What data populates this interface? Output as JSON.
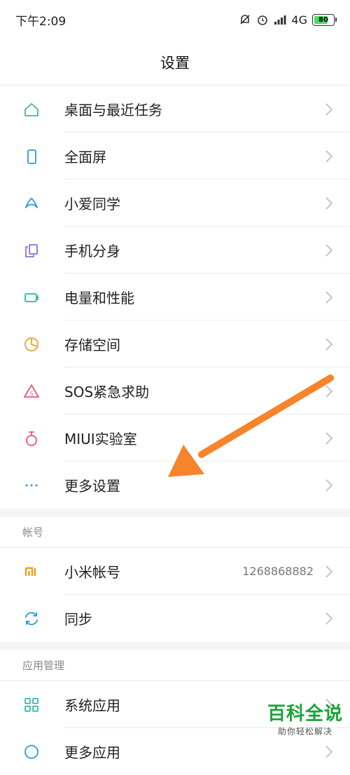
{
  "status_bar": {
    "time": "下午2:09",
    "network": "4G",
    "battery_level": "80",
    "battery_fraction": 0.8
  },
  "header": {
    "title": "设置"
  },
  "sections": [
    {
      "header": "",
      "items": [
        {
          "label": "桌面与最近任务",
          "icon": "home-icon",
          "color": "#3fb6a8"
        },
        {
          "label": "全面屏",
          "icon": "phone-icon",
          "color": "#2a9bd8"
        },
        {
          "label": "小爱同学",
          "icon": "assistant-icon",
          "color": "#2a9bd8"
        },
        {
          "label": "手机分身",
          "icon": "dual-space-icon",
          "color": "#8a6fd6"
        },
        {
          "label": "电量和性能",
          "icon": "battery-icon",
          "color": "#2bb5a0"
        },
        {
          "label": "存储空间",
          "icon": "storage-icon",
          "color": "#f0a22b"
        },
        {
          "label": "SOS紧急求助",
          "icon": "sos-icon",
          "color": "#e8577a"
        },
        {
          "label": "MIUI实验室",
          "icon": "flask-icon",
          "color": "#e8577a"
        },
        {
          "label": "更多设置",
          "icon": "more-dots-icon",
          "color": "#2a9bd8"
        }
      ]
    },
    {
      "header": "帐号",
      "items": [
        {
          "label": "小米帐号",
          "value": "1268868882",
          "icon": "mi-icon",
          "color": "#f39b1c"
        },
        {
          "label": "同步",
          "icon": "sync-icon",
          "color": "#2a9bd8"
        }
      ]
    },
    {
      "header": "应用管理",
      "items": [
        {
          "label": "系统应用",
          "icon": "apps-grid-icon",
          "color": "#3fb6a8"
        },
        {
          "label": "更多应用",
          "icon": "more-apps-icon",
          "color": "#2a9bd8"
        }
      ]
    }
  ],
  "watermark": {
    "title": "百科全说",
    "subtitle": "助你轻松解决"
  },
  "colors": {
    "arrow": "#f7842a",
    "watermark": "#1aa33a"
  }
}
